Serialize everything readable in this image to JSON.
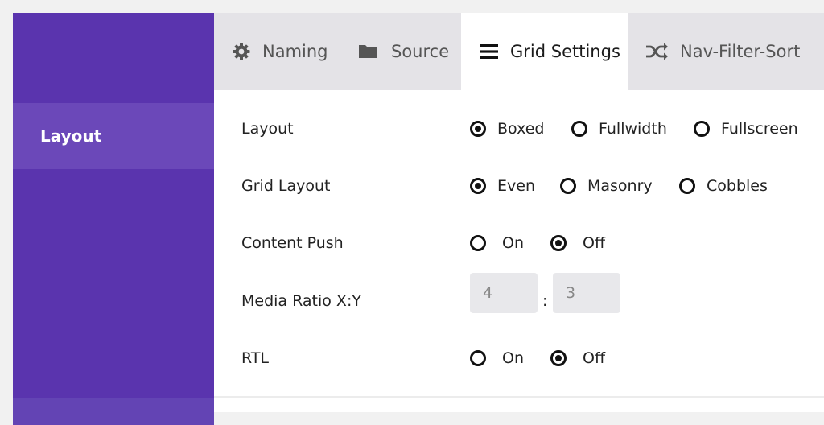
{
  "sidebar": {
    "items": [
      {
        "label": "Layout",
        "active": true
      }
    ]
  },
  "tabs": [
    {
      "label": "Naming",
      "icon": "gear-icon",
      "active": false
    },
    {
      "label": "Source",
      "icon": "folder-icon",
      "active": false
    },
    {
      "label": "Grid Settings",
      "icon": "menu-icon",
      "active": true
    },
    {
      "label": "Nav-Filter-Sort",
      "icon": "shuffle-icon",
      "active": false
    }
  ],
  "settings": {
    "layout": {
      "label": "Layout",
      "options": [
        "Boxed",
        "Fullwidth",
        "Fullscreen"
      ],
      "selected": "Boxed"
    },
    "grid_layout": {
      "label": "Grid Layout",
      "options": [
        "Even",
        "Masonry",
        "Cobbles"
      ],
      "selected": "Even"
    },
    "content_push": {
      "label": "Content Push",
      "options": [
        "On",
        "Off"
      ],
      "selected": "Off"
    },
    "media_ratio": {
      "label": "Media Ratio X:Y",
      "x": "4",
      "separator": ":",
      "y": "3"
    },
    "rtl": {
      "label": "RTL",
      "options": [
        "On",
        "Off"
      ],
      "selected": "Off"
    }
  },
  "colors": {
    "sidebar": "#5a34ae",
    "sidebar_active": "#6b48b9",
    "tab_bar": "#e4e3e7",
    "input_bg": "#e8e8eb"
  }
}
